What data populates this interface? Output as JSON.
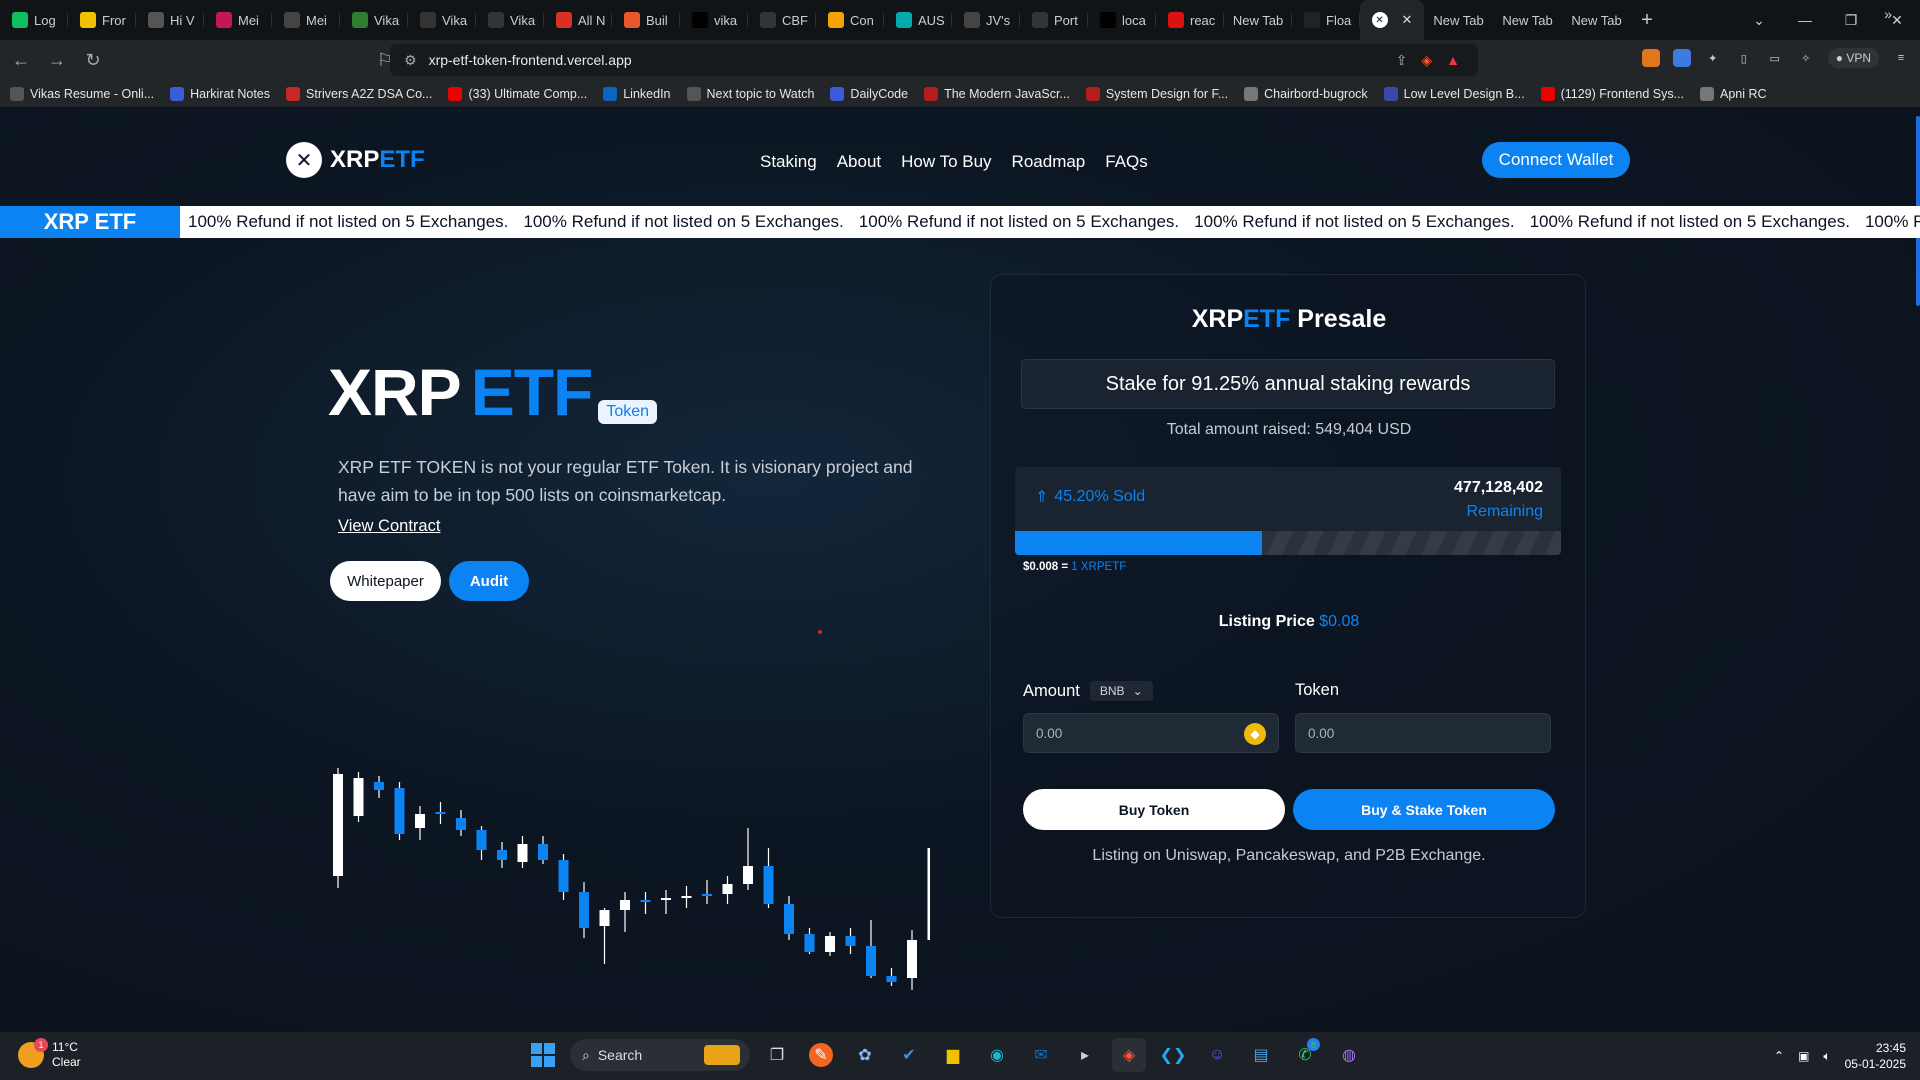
{
  "browser": {
    "tabs": [
      {
        "label": "Log",
        "icon": "tab-favicon-l",
        "color": "#0fbf5f"
      },
      {
        "label": "Fror",
        "icon": "tab-favicon-f",
        "color": "#f2c200"
      },
      {
        "label": "Hi V",
        "icon": "tab-favicon-h",
        "color": "#555"
      },
      {
        "label": "Mei",
        "icon": "tab-favicon-m",
        "color": "#c2185b"
      },
      {
        "label": "Mei",
        "icon": "tab-favicon-m2",
        "color": "#444"
      },
      {
        "label": "Vika",
        "icon": "tab-favicon-v",
        "color": "#2e7d32"
      },
      {
        "label": "Vika",
        "icon": "github-icon",
        "color": "#333"
      },
      {
        "label": "Vika",
        "icon": "github-icon",
        "color": "#333"
      },
      {
        "label": "All N",
        "icon": "gmail-icon",
        "color": "#d93025"
      },
      {
        "label": "Buil",
        "icon": "tab-favicon-b",
        "color": "#e8572c"
      },
      {
        "label": "vika",
        "icon": "vercel-icon",
        "color": "#000"
      },
      {
        "label": "CBF",
        "icon": "tab-favicon-c",
        "color": "#333"
      },
      {
        "label": "Con",
        "icon": "tab-favicon-co",
        "color": "#f4a300"
      },
      {
        "label": "AUS",
        "icon": "tab-favicon-a",
        "color": "#0aa"
      },
      {
        "label": "JV's",
        "icon": "tab-favicon-j",
        "color": "#444"
      },
      {
        "label": "Port",
        "icon": "tab-favicon-p",
        "color": "#333"
      },
      {
        "label": "loca",
        "icon": "vercel-icon",
        "color": "#000"
      },
      {
        "label": "reac",
        "icon": "tab-favicon-r",
        "color": "#d11"
      },
      {
        "label": "New Tab",
        "icon": "",
        "color": ""
      },
      {
        "label": "Floa",
        "icon": "tab-favicon-fl",
        "color": "#222"
      }
    ],
    "active_tab_close": "✕",
    "extra_tabs": [
      "New Tab",
      "New Tab",
      "New Tab"
    ],
    "url": "xrp-etf-token-frontend.vercel.app",
    "vpn_label": "VPN",
    "bookmarks": [
      {
        "label": "Vikas Resume - Onli...",
        "color": "#555"
      },
      {
        "label": "Harkirat Notes",
        "color": "#3b5bdb"
      },
      {
        "label": "Strivers A2Z DSA Co...",
        "color": "#c62828"
      },
      {
        "label": "(33) Ultimate Comp...",
        "color": "#e00"
      },
      {
        "label": "LinkedIn",
        "color": "#0a66c2"
      },
      {
        "label": "Next topic to Watch",
        "color": "#555"
      },
      {
        "label": "DailyCode",
        "color": "#3b5bdb"
      },
      {
        "label": "The Modern JavaScr...",
        "color": "#b71c1c"
      },
      {
        "label": "System Design for F...",
        "color": "#b71c1c"
      },
      {
        "label": "Chairbord-bugrock",
        "color": "#777"
      },
      {
        "label": "Low Level Design B...",
        "color": "#3949ab"
      },
      {
        "label": "(1129) Frontend Sys...",
        "color": "#e00"
      },
      {
        "label": "Apni RC",
        "color": "#777"
      }
    ]
  },
  "site": {
    "logo": {
      "primary": "XRP",
      "accent": "ETF"
    },
    "nav": [
      "Staking",
      "About",
      "How To Buy",
      "Roadmap",
      "FAQs"
    ],
    "connect_wallet": "Connect Wallet",
    "ticker_label": "XRP ETF",
    "ticker_text": "100% Refund if not listed on 5 Exchanges.",
    "hero": {
      "title_primary": "XRP",
      "title_accent": "ETF",
      "badge": "Token",
      "description": "XRP ETF TOKEN is not your regular ETF Token. It is visionary project and have aim to be in top 500 lists on coinsmarketcap.",
      "view_contract": "View Contract",
      "whitepaper": "Whitepaper",
      "audit": "Audit"
    },
    "presale": {
      "title_primary": "XRP",
      "title_accent": "ETF",
      "title_suffix": "Presale",
      "stake_banner": "Stake for 91.25% annual staking rewards",
      "total_raised": "Total amount raised: 549,404 USD",
      "sold_label": "45.20% Sold",
      "sold_fraction": 0.452,
      "remaining_value": "477,128,402",
      "remaining_label": "Remaining",
      "rate_price": "$0.008 =",
      "rate_token": "1 XRPETF",
      "listing_label": "Listing Price",
      "listing_value": "$0.08",
      "amount_label": "Amount",
      "currency": "BNB",
      "token_label": "Token",
      "amount_placeholder": "0.00",
      "token_placeholder": "0.00",
      "buy_button": "Buy Token",
      "stake_button": "Buy & Stake Token",
      "listing_on": "Listing on Uniswap, Pancakeswap, and P2B Exchange."
    },
    "accent_color": "#0c83f2"
  },
  "chart_data": {
    "type": "candlestick",
    "colors": {
      "up": "#ffffff",
      "down": "#0c83f2"
    },
    "candles": [
      {
        "o": 108,
        "c": 6,
        "h": -4,
        "l": 120,
        "dir": "up"
      },
      {
        "o": 10,
        "c": 48,
        "h": 4,
        "l": 54,
        "dir": "up"
      },
      {
        "o": 22,
        "c": 14,
        "h": 8,
        "l": 30,
        "dir": "down"
      },
      {
        "o": 20,
        "c": 66,
        "h": 14,
        "l": 72,
        "dir": "down"
      },
      {
        "o": 60,
        "c": 46,
        "h": 38,
        "l": 72,
        "dir": "up"
      },
      {
        "o": 46,
        "c": 44,
        "h": 34,
        "l": 56,
        "dir": "down"
      },
      {
        "o": 50,
        "c": 62,
        "h": 42,
        "l": 68,
        "dir": "down"
      },
      {
        "o": 62,
        "c": 82,
        "h": 58,
        "l": 92,
        "dir": "down"
      },
      {
        "o": 82,
        "c": 92,
        "h": 74,
        "l": 100,
        "dir": "down"
      },
      {
        "o": 94,
        "c": 76,
        "h": 68,
        "l": 100,
        "dir": "up"
      },
      {
        "o": 76,
        "c": 92,
        "h": 68,
        "l": 96,
        "dir": "down"
      },
      {
        "o": 92,
        "c": 124,
        "h": 86,
        "l": 132,
        "dir": "down"
      },
      {
        "o": 124,
        "c": 160,
        "h": 114,
        "l": 170,
        "dir": "down"
      },
      {
        "o": 158,
        "c": 142,
        "h": 140,
        "l": 196,
        "dir": "up"
      },
      {
        "o": 142,
        "c": 132,
        "h": 124,
        "l": 164,
        "dir": "up"
      },
      {
        "o": 132,
        "c": 132,
        "h": 124,
        "l": 146,
        "dir": "down"
      },
      {
        "o": 132,
        "c": 130,
        "h": 122,
        "l": 146,
        "dir": "up"
      },
      {
        "o": 130,
        "c": 128,
        "h": 118,
        "l": 140,
        "dir": "up"
      },
      {
        "o": 128,
        "c": 126,
        "h": 112,
        "l": 136,
        "dir": "down"
      },
      {
        "o": 126,
        "c": 116,
        "h": 108,
        "l": 136,
        "dir": "up"
      },
      {
        "o": 116,
        "c": 98,
        "h": 60,
        "l": 122,
        "dir": "up"
      },
      {
        "o": 98,
        "c": 136,
        "h": 80,
        "l": 140,
        "dir": "down"
      },
      {
        "o": 136,
        "c": 166,
        "h": 128,
        "l": 172,
        "dir": "down"
      },
      {
        "o": 166,
        "c": 184,
        "h": 160,
        "l": 186,
        "dir": "down"
      },
      {
        "o": 184,
        "c": 168,
        "h": 164,
        "l": 188,
        "dir": "up"
      },
      {
        "o": 168,
        "c": 178,
        "h": 160,
        "l": 186,
        "dir": "down"
      },
      {
        "o": 178,
        "c": 208,
        "h": 152,
        "l": 210,
        "dir": "down"
      },
      {
        "o": 208,
        "c": 214,
        "h": 200,
        "l": 218,
        "dir": "down"
      },
      {
        "o": 210,
        "c": 172,
        "h": 162,
        "l": 222,
        "dir": "up"
      },
      {
        "o": 172,
        "c": 80,
        "h": 62,
        "l": 206,
        "dir": "up"
      }
    ]
  },
  "taskbar": {
    "temp": "11°C",
    "condition": "Clear",
    "weather_badge": "1",
    "search_label": "Search",
    "time": "23:45",
    "date": "05-01-2025",
    "whatsapp_badge": "8"
  }
}
